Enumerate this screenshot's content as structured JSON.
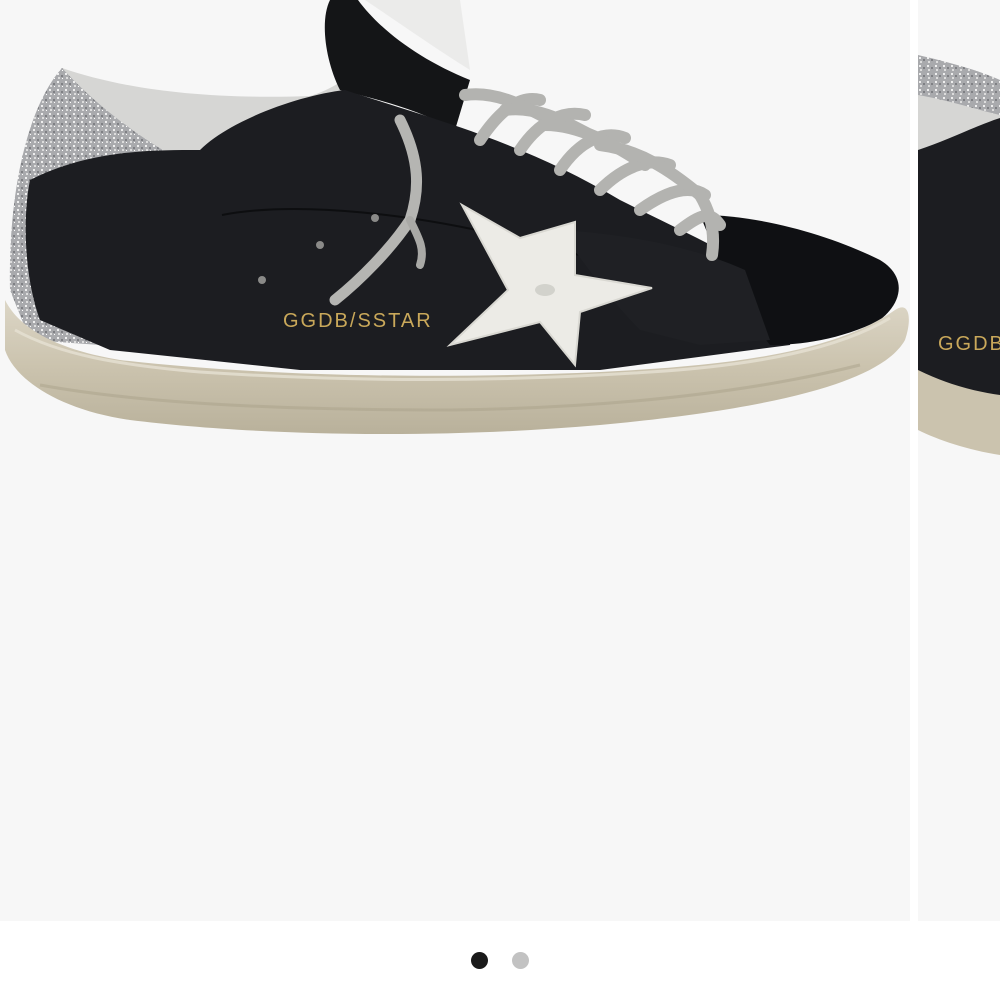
{
  "product": {
    "brand_print": "GGDB/SSTAR",
    "brand_print_partial": "GGDB/"
  },
  "carousel": {
    "slide_count": 2,
    "active_index": 0
  },
  "colors": {
    "background": "#f7f7f7",
    "upper_black": "#1c1d21",
    "suede_black": "#101114",
    "sole": "#cfc8b6",
    "star": "#ecebe6",
    "glitter": "#b9babd",
    "laces": "#b5b5b2",
    "gold_print": "#c9a85a",
    "dot_active": "#1a1a1a",
    "dot_inactive": "#c2c2c2"
  },
  "icons": {
    "heel": "glitter-heel-tab",
    "star": "star-patch"
  }
}
